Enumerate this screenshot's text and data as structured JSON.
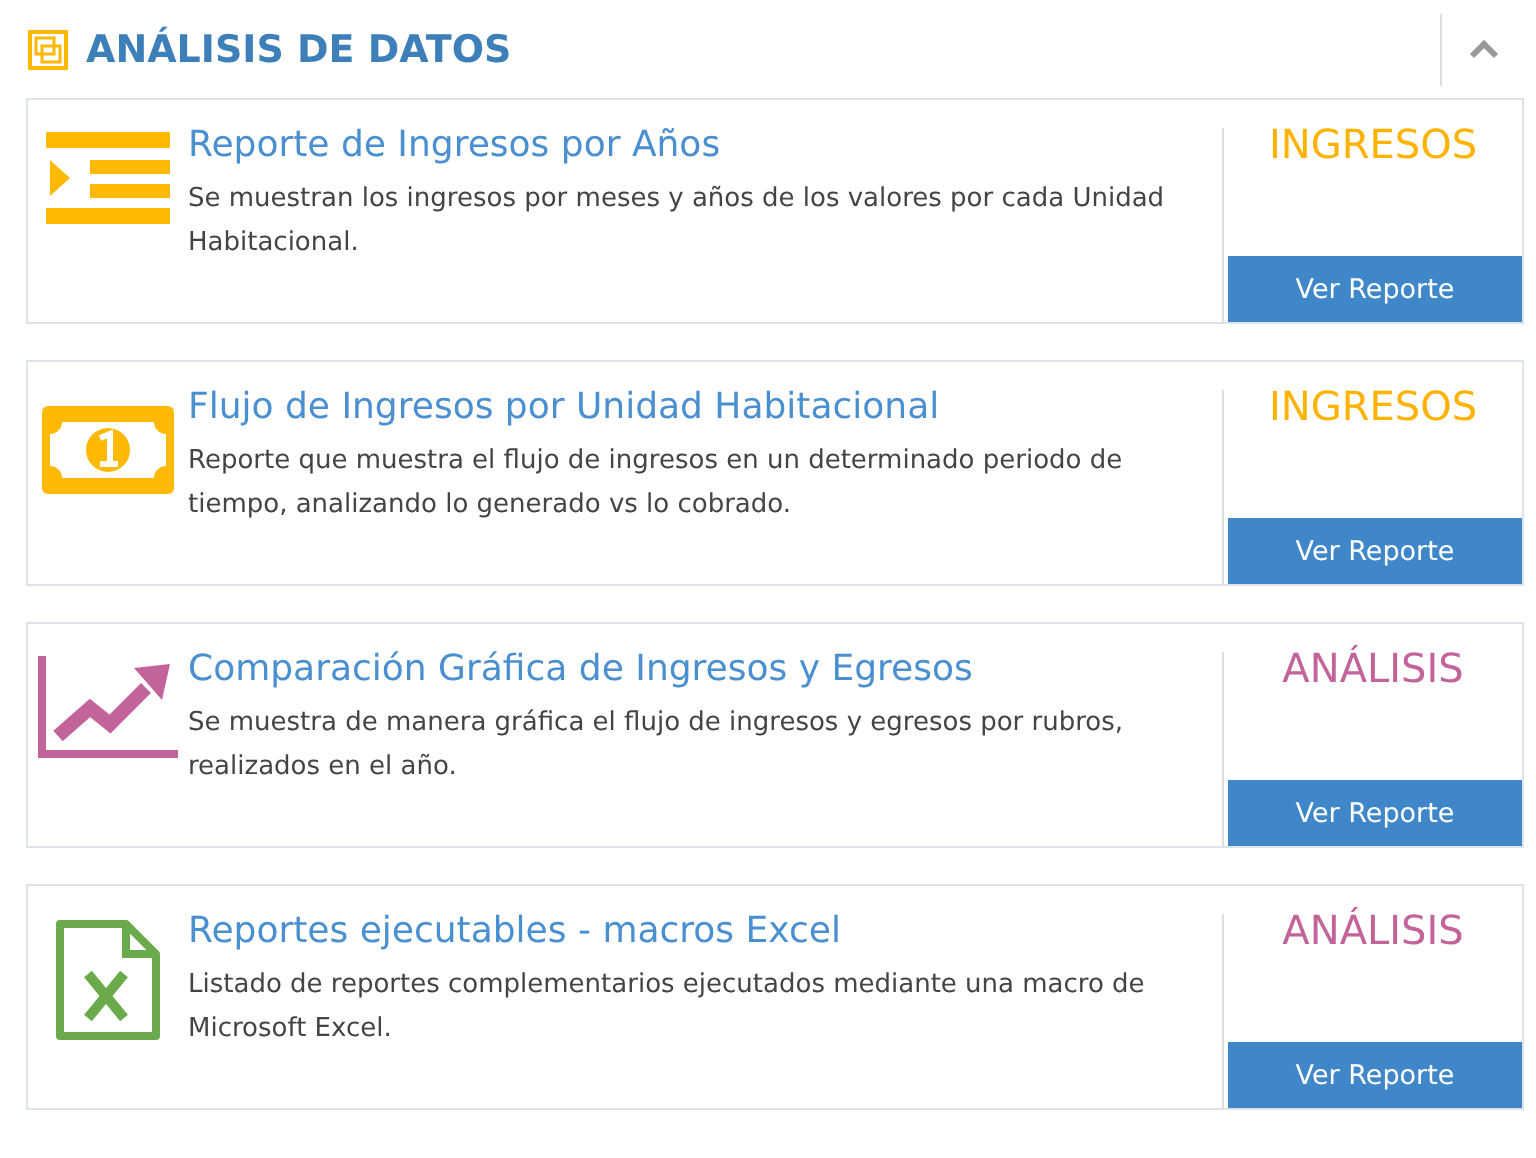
{
  "panel": {
    "title": "ANÁLISIS DE DATOS",
    "collapsed": false
  },
  "reports": [
    {
      "title": "Reporte de Ingresos por Años",
      "description": "Se muestran los ingresos por meses y años de los valores por cada Unidad Habitacional.",
      "category": "INGRESOS",
      "color": "#ffb300",
      "button": "Ver Reporte"
    },
    {
      "title": "Flujo de Ingresos por Unidad Habitacional",
      "description": "Reporte que muestra el flujo de ingresos en un determinado periodo de tiempo, analizando lo generado vs lo cobrado.",
      "category": "INGRESOS",
      "color": "#ffb300",
      "button": "Ver Reporte"
    },
    {
      "title": "Comparación Gráfica de Ingresos y Egresos",
      "description": "Se muestra de manera gráfica el flujo de ingresos y egresos por rubros, realizados en el año.",
      "category": "ANÁLISIS",
      "color": "#c2649a",
      "button": "Ver Reporte"
    },
    {
      "title": "Reportes ejecutables - macros Excel",
      "description": "Listado de reportes complementarios ejecutados mediante una macro de Microsoft Excel.",
      "category": "ANÁLISIS",
      "color": "#c2649a",
      "button": "Ver Reporte"
    }
  ]
}
